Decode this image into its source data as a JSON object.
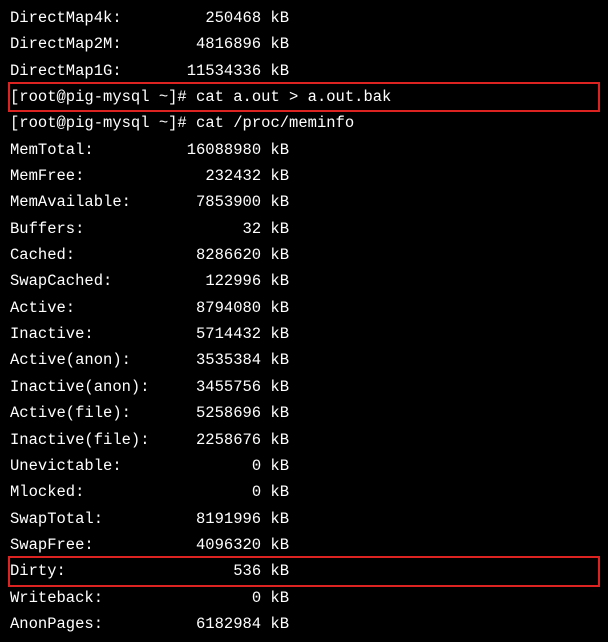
{
  "top_rows": [
    {
      "label": "DirectMap4k:",
      "value": "250468",
      "unit": " kB"
    },
    {
      "label": "DirectMap2M:",
      "value": "4816896",
      "unit": " kB"
    },
    {
      "label": "DirectMap1G:",
      "value": "11534336",
      "unit": " kB"
    }
  ],
  "cmd1_prompt": "[root@pig-mysql ~]# ",
  "cmd1_text": "cat a.out > a.out.bak",
  "cmd2_prompt": "[root@pig-mysql ~]# ",
  "cmd2_text": "cat /proc/meminfo",
  "rows_a": [
    {
      "label": "MemTotal:",
      "value": "16088980",
      "unit": " kB"
    },
    {
      "label": "MemFree:",
      "value": "232432",
      "unit": " kB"
    },
    {
      "label": "MemAvailable:",
      "value": "7853900",
      "unit": " kB"
    },
    {
      "label": "Buffers:",
      "value": "32",
      "unit": " kB"
    },
    {
      "label": "Cached:",
      "value": "8286620",
      "unit": " kB"
    },
    {
      "label": "SwapCached:",
      "value": "122996",
      "unit": " kB"
    },
    {
      "label": "Active:",
      "value": "8794080",
      "unit": " kB"
    },
    {
      "label": "Inactive:",
      "value": "5714432",
      "unit": " kB"
    },
    {
      "label": "Active(anon):",
      "value": "3535384",
      "unit": " kB"
    },
    {
      "label": "Inactive(anon):",
      "value": "3455756",
      "unit": " kB"
    },
    {
      "label": "Active(file):",
      "value": "5258696",
      "unit": " kB"
    },
    {
      "label": "Inactive(file):",
      "value": "2258676",
      "unit": " kB"
    },
    {
      "label": "Unevictable:",
      "value": "0",
      "unit": " kB"
    },
    {
      "label": "Mlocked:",
      "value": "0",
      "unit": " kB"
    },
    {
      "label": "SwapTotal:",
      "value": "8191996",
      "unit": " kB"
    },
    {
      "label": "SwapFree:",
      "value": "4096320",
      "unit": " kB"
    }
  ],
  "row_dirty": {
    "label": "Dirty:",
    "value": "536",
    "unit": " kB"
  },
  "rows_b": [
    {
      "label": "Writeback:",
      "value": "0",
      "unit": " kB"
    },
    {
      "label": "AnonPages:",
      "value": "6182984",
      "unit": " kB"
    }
  ]
}
